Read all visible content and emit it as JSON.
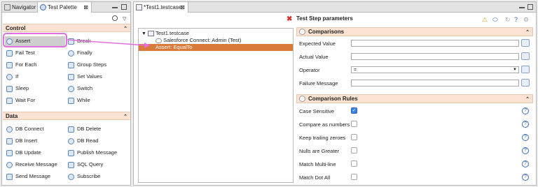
{
  "left_tabs": {
    "navigator": "Navigator",
    "palette": "Test Palette",
    "close": "⊠"
  },
  "control": {
    "title": "Control",
    "items": [
      {
        "label": "Assert",
        "icon": "assert-icon"
      },
      {
        "label": "Break",
        "icon": "break-icon"
      },
      {
        "label": "Fail Test",
        "icon": "fail-test-icon"
      },
      {
        "label": "Finally",
        "icon": "finally-icon"
      },
      {
        "label": "For Each",
        "icon": "for-each-icon"
      },
      {
        "label": "Group Steps",
        "icon": "group-steps-icon"
      },
      {
        "label": "If",
        "icon": "if-icon"
      },
      {
        "label": "Set Values",
        "icon": "set-values-icon"
      },
      {
        "label": "Sleep",
        "icon": "sleep-icon"
      },
      {
        "label": "Switch",
        "icon": "switch-icon"
      },
      {
        "label": "Wait For",
        "icon": "wait-for-icon"
      },
      {
        "label": "While",
        "icon": "while-icon"
      }
    ]
  },
  "data_section": {
    "title": "Data",
    "items": [
      {
        "label": "DB Connect",
        "icon": "db-connect-icon"
      },
      {
        "label": "DB Delete",
        "icon": "db-delete-icon"
      },
      {
        "label": "DB Insert",
        "icon": "db-insert-icon"
      },
      {
        "label": "DB Read",
        "icon": "db-read-icon"
      },
      {
        "label": "DB Update",
        "icon": "db-update-icon"
      },
      {
        "label": "Publish Message",
        "icon": "publish-message-icon"
      },
      {
        "label": "Receive Message",
        "icon": "receive-message-icon"
      },
      {
        "label": "SQL Query",
        "icon": "sql-query-icon"
      },
      {
        "label": "Send Message",
        "icon": "send-message-icon"
      },
      {
        "label": "Subscribe",
        "icon": "subscribe-icon"
      }
    ]
  },
  "editor": {
    "tab": "*Test1.testcase",
    "close": "⊠"
  },
  "tree": {
    "root": "Test1.testcase",
    "child1": "Salesforce Connect: Admin (Test)",
    "child2": "Assert:  EqualTo"
  },
  "params": {
    "title": "Test Step parameters",
    "comparisons": {
      "title": "Comparisons",
      "fields": [
        "Expected Value",
        "Actual Value",
        "Operator",
        "Failure Message"
      ],
      "operator_value": "="
    },
    "rules": {
      "title": "Comparison Rules",
      "items": [
        {
          "label": "Case Sensitive",
          "checked": true
        },
        {
          "label": "Compare as numbers",
          "checked": false
        },
        {
          "label": "Keep trailing zeroes",
          "checked": false
        },
        {
          "label": "Nulls are Greater",
          "checked": false
        },
        {
          "label": "Match Multi-line",
          "checked": false
        },
        {
          "label": "Match Dot All",
          "checked": false
        }
      ]
    }
  },
  "colors": {
    "accent": "#d9793a",
    "section": "#fbe3d3",
    "highlight_border": "#e070e0"
  }
}
